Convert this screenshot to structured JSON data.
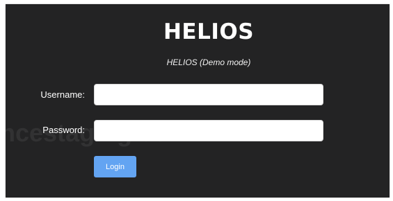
{
  "header": {
    "title": "HELIOS",
    "subtitle": "HELIOS (Demo mode)"
  },
  "form": {
    "username_label": "Username:",
    "username_value": "",
    "password_label": "Password:",
    "password_value": "",
    "login_label": "Login"
  },
  "watermark": {
    "text": "ncestaging.com"
  },
  "colors": {
    "panel_background": "#232324",
    "page_background": "#ffffff",
    "login_button": "#63a4f2",
    "field_background": "#ffffff",
    "text": "#ffffff"
  }
}
